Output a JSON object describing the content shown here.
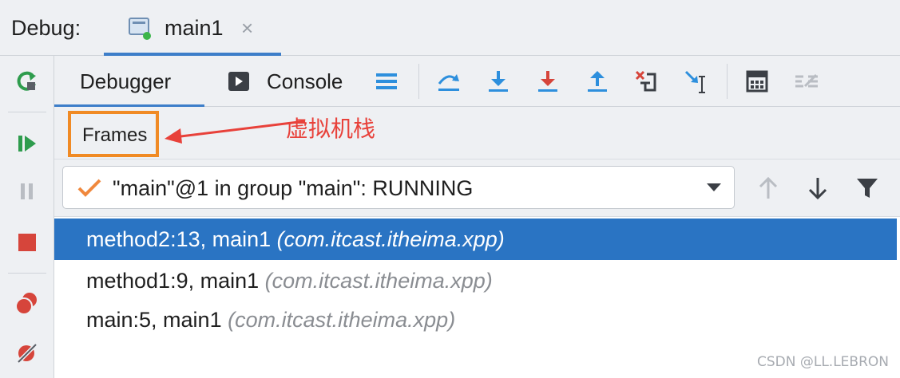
{
  "debug_bar": {
    "label": "Debug:",
    "run_tab": {
      "label": "main1",
      "close": "×"
    }
  },
  "tool_tabs": {
    "debugger": "Debugger",
    "console": "Console"
  },
  "frames": {
    "label": "Frames",
    "annotation": "虚拟机栈"
  },
  "thread_selector": {
    "value": "\"main\"@1 in group \"main\": RUNNING"
  },
  "stack_frames": [
    {
      "method": "method2:13, main1",
      "package": "(com.itcast.itheima.xpp)",
      "selected": true
    },
    {
      "method": "method1:9, main1",
      "package": "(com.itcast.itheima.xpp)",
      "selected": false
    },
    {
      "method": "main:5, main1",
      "package": "(com.itcast.itheima.xpp)",
      "selected": false
    }
  ],
  "watermark": "CSDN @LL.LEBRON",
  "icons": {
    "rerun": "rerun-icon",
    "resume": "resume-icon",
    "pause": "pause-icon",
    "stop": "stop-icon",
    "view_breakpoints": "view-breakpoints-icon",
    "mute_breakpoints": "mute-breakpoints-icon",
    "layout": "layout-icon",
    "step_over": "step-over-icon",
    "step_into": "step-into-icon",
    "force_step_into": "force-step-into-icon",
    "step_out": "step-out-icon",
    "drop_frame": "drop-frame-icon",
    "run_to_cursor": "run-to-cursor-icon",
    "evaluate": "evaluate-expression-icon",
    "trace": "trace-icon"
  },
  "colors": {
    "accent": "#3d7ec9",
    "selection": "#2a74c3",
    "highlight_box": "#f08a24",
    "annotation": "#e8413a",
    "green": "#2e9c4d",
    "red": "#d6453b",
    "blue": "#2d8fdd"
  }
}
